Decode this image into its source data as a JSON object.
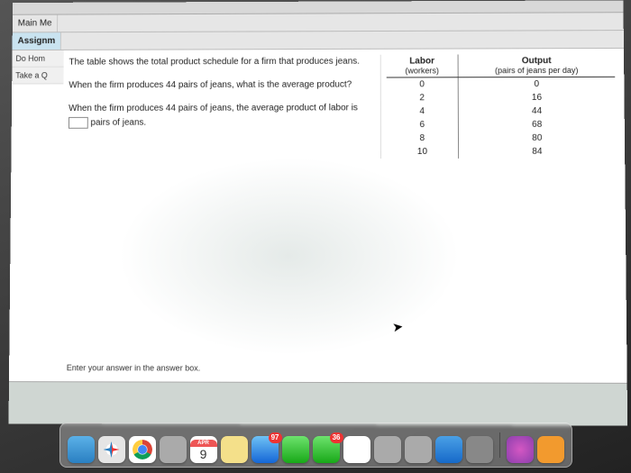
{
  "nav": {
    "main": "Main Me",
    "assign": "Assignm",
    "dohome": "Do Hom",
    "take": "Take a Q"
  },
  "question": {
    "intro": "The table shows the total product schedule for a firm that produces jeans.",
    "prompt": "When the firm produces 44 pairs of jeans, what is the average product?",
    "fill_before": "When the firm produces 44 pairs of jeans, the average product of labor is",
    "fill_after": "pairs of jeans.",
    "footer": "Enter your answer in the answer box."
  },
  "table": {
    "head_labor": "Labor",
    "head_labor_sub": "(workers)",
    "head_output": "Output",
    "head_output_sub": "(pairs of jeans per day)",
    "rows": [
      {
        "labor": "0",
        "output": "0"
      },
      {
        "labor": "2",
        "output": "16"
      },
      {
        "labor": "4",
        "output": "44"
      },
      {
        "labor": "6",
        "output": "68"
      },
      {
        "labor": "8",
        "output": "80"
      },
      {
        "labor": "10",
        "output": "84"
      }
    ]
  },
  "dock": {
    "cal_month": "APR",
    "cal_day": "9",
    "mail_badge": "97",
    "messages_badge": "36"
  }
}
